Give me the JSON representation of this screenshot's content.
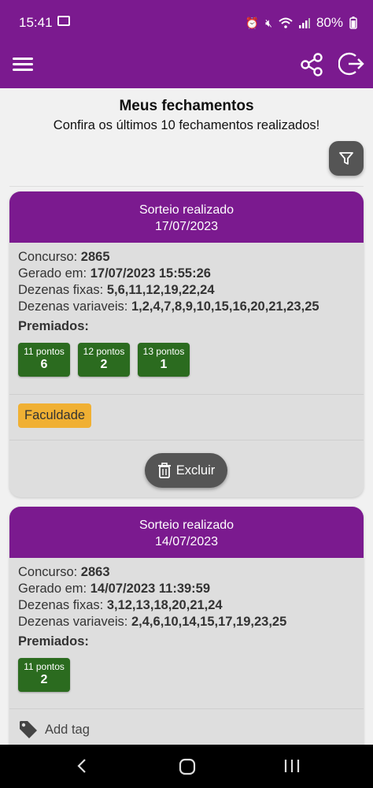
{
  "status_bar": {
    "time": "15:41",
    "battery": "80%"
  },
  "header": {
    "title": "Meus fechamentos",
    "subtitle": "Confira os últimos 10 fechamentos realizados!"
  },
  "cards": [
    {
      "status": "Sorteio realizado",
      "date": "17/07/2023",
      "concurso_label": "Concurso:",
      "concurso": "2865",
      "gerado_label": "Gerado em:",
      "gerado": "17/07/2023 15:55:26",
      "fixas_label": "Dezenas fixas:",
      "fixas": "5,6,11,12,19,22,24",
      "variaveis_label": "Dezenas variaveis:",
      "variaveis": "1,2,4,7,8,9,10,15,16,20,21,23,25",
      "premiados_label": "Premiados:",
      "prizes": [
        {
          "label": "11 pontos",
          "count": "6"
        },
        {
          "label": "12 pontos",
          "count": "2"
        },
        {
          "label": "13 pontos",
          "count": "1"
        }
      ],
      "tag": "Faculdade",
      "delete_label": "Excluir"
    },
    {
      "status": "Sorteio realizado",
      "date": "14/07/2023",
      "concurso_label": "Concurso:",
      "concurso": "2863",
      "gerado_label": "Gerado em:",
      "gerado": "14/07/2023 11:39:59",
      "fixas_label": "Dezenas fixas:",
      "fixas": "3,12,13,18,20,21,24",
      "variaveis_label": "Dezenas variaveis:",
      "variaveis": "2,4,6,10,14,15,17,19,23,25",
      "premiados_label": "Premiados:",
      "prizes": [
        {
          "label": "11 pontos",
          "count": "2"
        }
      ],
      "add_tag_label": "Add tag"
    }
  ],
  "colors": {
    "primary": "#7b1a8f",
    "prize_green": "#2b6b1f",
    "tag_orange": "#f0b033",
    "button_gray": "#555555"
  },
  "icons": [
    "menu-icon",
    "share-icon",
    "logout-icon",
    "filter-icon",
    "trash-icon",
    "tag-icon",
    "nav-back-icon",
    "nav-home-icon",
    "nav-recents-icon"
  ]
}
